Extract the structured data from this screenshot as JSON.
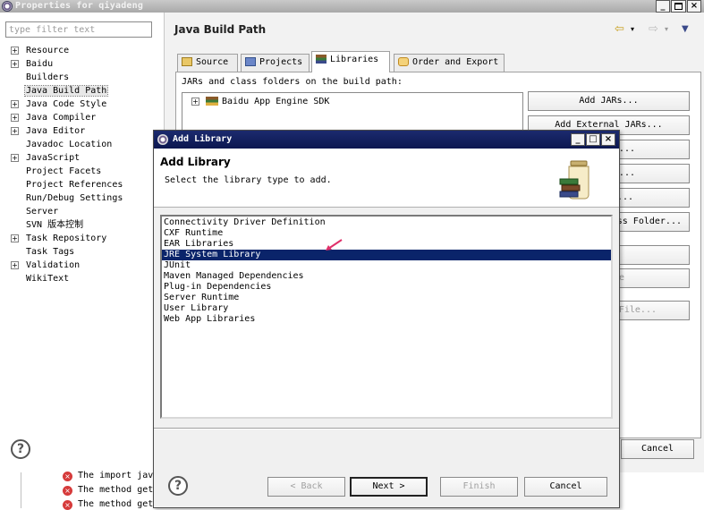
{
  "properties_window": {
    "title": "Properties for qiyadeng",
    "filter": {
      "placeholder": "type filter text"
    },
    "nav_items": [
      {
        "label": "Resource",
        "expandable": true
      },
      {
        "label": "Baidu",
        "expandable": true
      },
      {
        "label": "Builders",
        "expandable": false
      },
      {
        "label": "Java Build Path",
        "expandable": false,
        "selected": true
      },
      {
        "label": "Java Code Style",
        "expandable": true
      },
      {
        "label": "Java Compiler",
        "expandable": true
      },
      {
        "label": "Java Editor",
        "expandable": true
      },
      {
        "label": "Javadoc Location",
        "expandable": false
      },
      {
        "label": "JavaScript",
        "expandable": true
      },
      {
        "label": "Project Facets",
        "expandable": false
      },
      {
        "label": "Project References",
        "expandable": false
      },
      {
        "label": "Run/Debug Settings",
        "expandable": false
      },
      {
        "label": "Server",
        "expandable": false
      },
      {
        "label": "SVN 版本控制",
        "expandable": false
      },
      {
        "label": "Task Repository",
        "expandable": true
      },
      {
        "label": "Task Tags",
        "expandable": false
      },
      {
        "label": "Validation",
        "expandable": true
      },
      {
        "label": "WikiText",
        "expandable": false
      }
    ],
    "page_title": "Java Build Path",
    "tabs": [
      {
        "label": "Source",
        "icon": "source-folder-icon"
      },
      {
        "label": "Projects",
        "icon": "projects-folder-icon"
      },
      {
        "label": "Libraries",
        "icon": "libraries-icon",
        "active": true
      },
      {
        "label": "Order and Export",
        "icon": "order-export-icon"
      }
    ],
    "jars_label": "JARs and class folders on the build path:",
    "build_path_entries": [
      {
        "label": "Baidu App Engine SDK",
        "expandable": true
      }
    ],
    "side_buttons": [
      {
        "label": "Add JARs...",
        "enabled": true
      },
      {
        "label": "Add External JARs...",
        "enabled": true
      },
      {
        "label": "ble...",
        "enabled": true
      },
      {
        "label": "ry...",
        "enabled": true
      },
      {
        "label": "lder...",
        "enabled": true
      },
      {
        "label": "ss Folder...",
        "enabled": true
      },
      {
        "label": "",
        "enabled": false
      },
      {
        "label": "e",
        "enabled": false
      },
      {
        "label": "File...",
        "enabled": false
      }
    ],
    "cancel_label": "Cancel",
    "help_glyph": "?",
    "controls": {
      "minimize": "_",
      "close": "×"
    },
    "nav_glyphs": {
      "back": "⇦",
      "forward": "⇨",
      "dropdown": "▾",
      "menu": "▼"
    }
  },
  "problems_view": {
    "rows": [
      {
        "text": "The import jav"
      },
      {
        "text": "The method get"
      },
      {
        "text": "The method get"
      }
    ],
    "error_glyph": "×"
  },
  "add_library_dialog": {
    "title": "Add Library",
    "header_title": "Add Library",
    "description": "Select the library type to add.",
    "controls": {
      "minimize": "_",
      "maximize": "□",
      "close": "×"
    },
    "libraries": [
      {
        "label": "Connectivity Driver Definition"
      },
      {
        "label": "CXF Runtime"
      },
      {
        "label": "EAR Libraries"
      },
      {
        "label": "JRE System Library",
        "selected": true
      },
      {
        "label": "JUnit"
      },
      {
        "label": "Maven Managed Dependencies"
      },
      {
        "label": "Plug-in Dependencies"
      },
      {
        "label": "Server Runtime"
      },
      {
        "label": "User Library"
      },
      {
        "label": "Web App Libraries"
      }
    ],
    "buttons": {
      "back": "< Back",
      "next": "Next >",
      "finish": "Finish",
      "cancel": "Cancel"
    },
    "help_glyph": "?"
  },
  "colors": {
    "dialog_titlebar": "#0b1750",
    "selection": "#0a246a",
    "arrow_annotation": "#e0306a",
    "error": "#d63b3b"
  }
}
